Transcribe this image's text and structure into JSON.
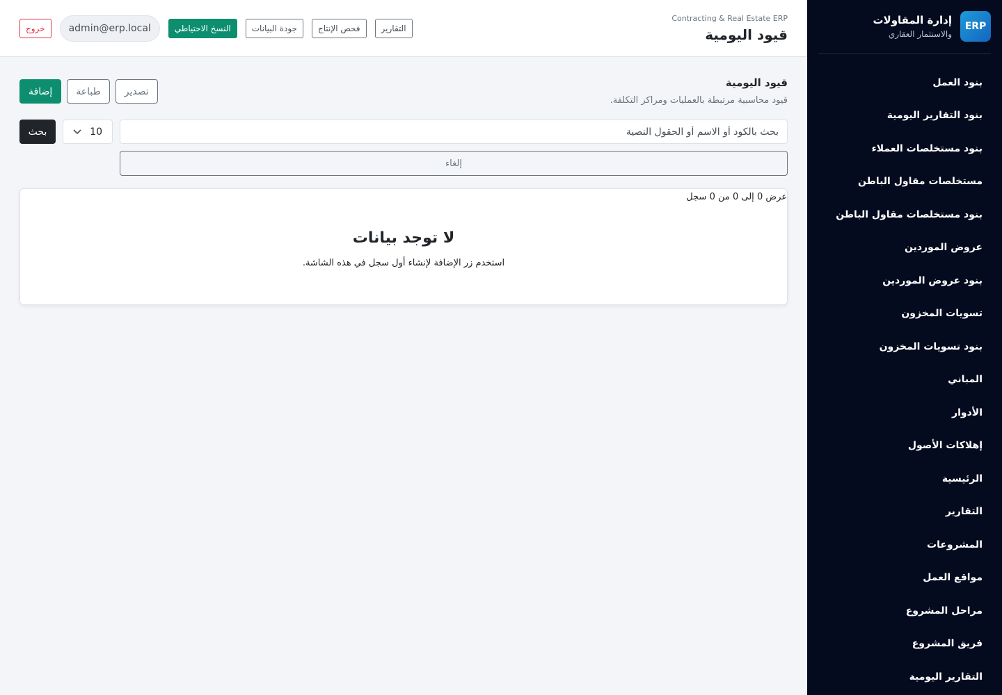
{
  "brand": {
    "logo": "ERP",
    "title": "إدارة المقاولات",
    "subtitle": "والاستثمار العقاري"
  },
  "sidebar": {
    "items": [
      {
        "label": "بنود العمل"
      },
      {
        "label": "بنود التقارير اليومية"
      },
      {
        "label": "بنود مستخلصات العملاء"
      },
      {
        "label": "مستخلصات مقاول الباطن"
      },
      {
        "label": "بنود مستخلصات مقاول الباطن"
      },
      {
        "label": "عروض الموردين"
      },
      {
        "label": "بنود عروض الموردين"
      },
      {
        "label": "تسويات المخزون"
      },
      {
        "label": "بنود تسويات المخزون"
      },
      {
        "label": "المباني"
      },
      {
        "label": "الأدوار"
      },
      {
        "label": "إهلاكات الأصول"
      },
      {
        "label": "الرئيسية"
      },
      {
        "label": "التقارير"
      },
      {
        "label": "المشروعات"
      },
      {
        "label": "مواقع العمل"
      },
      {
        "label": "مراحل المشروع"
      },
      {
        "label": "فريق المشروع"
      },
      {
        "label": "التقارير اليومية"
      }
    ]
  },
  "header": {
    "app_name": "Contracting & Real Estate ERP",
    "title": "قيود اليومية",
    "reports": "التقارير",
    "production_check": "فحص الإنتاج",
    "data_quality": "جودة البيانات",
    "backup": "النسخ الاحتياطي",
    "user": "admin@erp.local",
    "logout": "خروج"
  },
  "section": {
    "title": "قيود اليومية",
    "subtitle": "قيود محاسبية مرتبطة بالعمليات ومراكز التكلفة.",
    "export": "تصدير",
    "print": "طباعة",
    "add": "إضافة"
  },
  "search": {
    "placeholder": "بحث بالكود أو الاسم أو الحقول النصية",
    "page_size": "10",
    "button": "بحث",
    "cancel": "إلغاء"
  },
  "table": {
    "records_info": "عرض 0 إلى 0 من 0 سجل",
    "empty_title": "لا توجد بيانات",
    "empty_subtitle": "استخدم زر الإضافة لإنشاء أول سجل في هذه الشاشة."
  },
  "colors": {
    "sidebar_bg": "#050b1f",
    "accent_green": "#0d8f6f",
    "logout_red": "#dc3545"
  }
}
